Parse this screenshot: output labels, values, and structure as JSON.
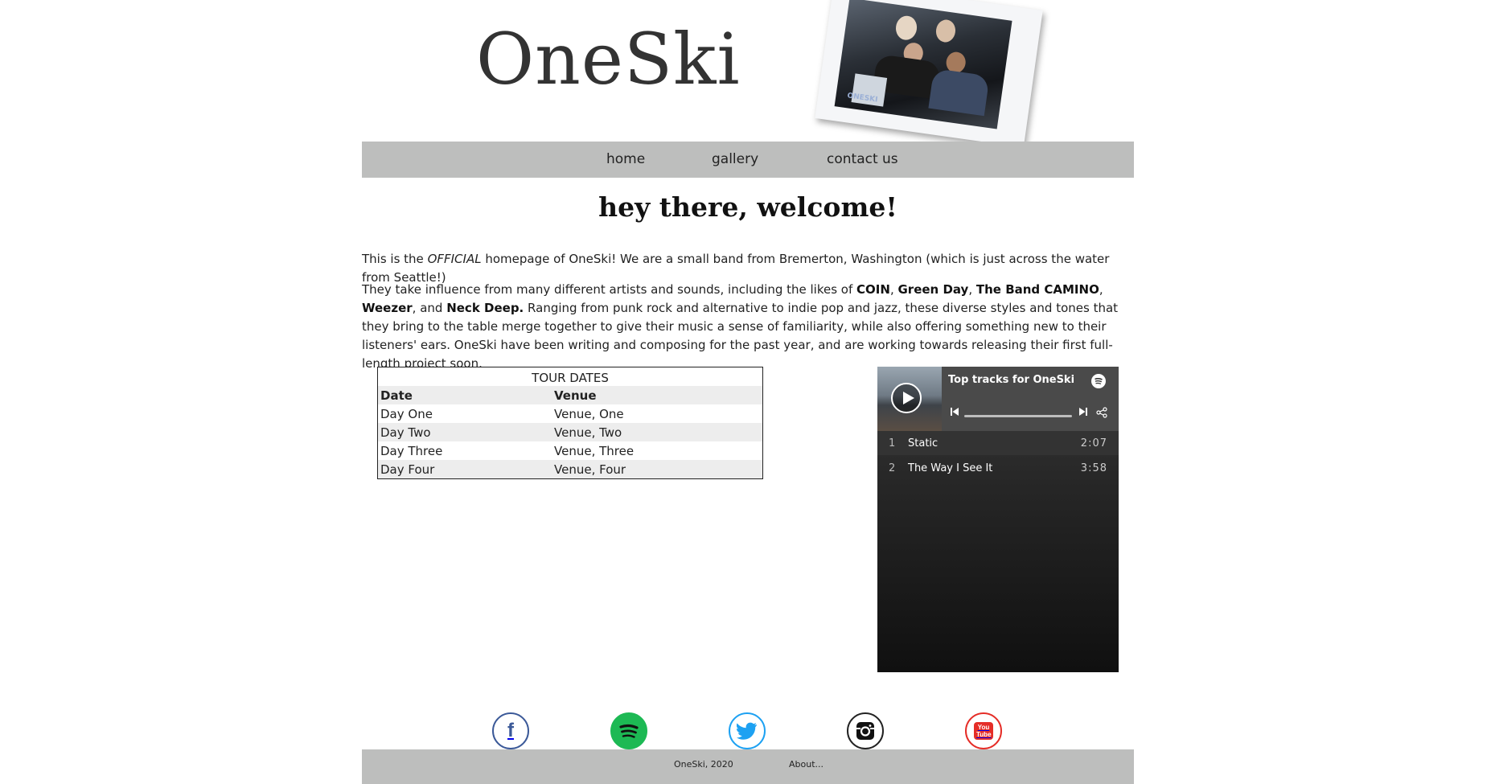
{
  "header": {
    "logo": "OneSki",
    "photo_caption": "ONESKI"
  },
  "nav": {
    "items": [
      {
        "label": "home"
      },
      {
        "label": "gallery"
      },
      {
        "label": "contact us"
      }
    ]
  },
  "main": {
    "title": "hey there, welcome!",
    "intro": {
      "pre": "This is the ",
      "emphasis": "OFFICIAL",
      "post": " homepage of OneSki! We are a small band from Bremerton, Washington (which is just across the water from Seattle!)"
    },
    "influences": {
      "t1": "They take influence from many different artists and sounds, including the likes of ",
      "a1": "COIN",
      "sep1": ", ",
      "a2": "Green Day",
      "sep2": ", ",
      "a3": "The Band CAMINO",
      "sep3": ", ",
      "a4": "Weezer",
      "sep4": ", and ",
      "a5": "Neck Deep.",
      "t2": " Ranging from punk rock and alternative to indie pop and jazz, these diverse styles and tones that they bring to the table merge together to give their music a sense of familiarity, while also offering something new to their listeners' ears. OneSki have been writing and composing for the past year, and are working towards releasing their first full-length project soon."
    }
  },
  "tour": {
    "caption": "TOUR DATES",
    "headers": [
      "Date",
      "Venue"
    ],
    "rows": [
      [
        "Day One",
        "Venue, One"
      ],
      [
        "Day Two",
        "Venue, Two"
      ],
      [
        "Day Three",
        "Venue, Three"
      ],
      [
        "Day Four",
        "Venue, Four"
      ]
    ]
  },
  "spotify": {
    "title": "Top tracks for OneSki",
    "tracks": [
      {
        "num": "1",
        "title": "Static",
        "duration": "2:07"
      },
      {
        "num": "2",
        "title": "The Way I See It",
        "duration": "3:58"
      }
    ],
    "colors": {
      "background": "#282828",
      "text": "#ffffff",
      "brand": "#1db954"
    }
  },
  "socials": [
    {
      "name": "facebook",
      "glyph": "f",
      "color": "#3b5998"
    },
    {
      "name": "spotify",
      "glyph": "",
      "color": "#1db954"
    },
    {
      "name": "twitter",
      "glyph": "",
      "color": "#1da1f2"
    },
    {
      "name": "instagram",
      "glyph": "",
      "color": "#222222"
    },
    {
      "name": "youtube",
      "glyph": "You Tube",
      "color": "#e52d27"
    }
  ],
  "footer": {
    "copyright": "OneSki, 2020",
    "about": "About..."
  }
}
